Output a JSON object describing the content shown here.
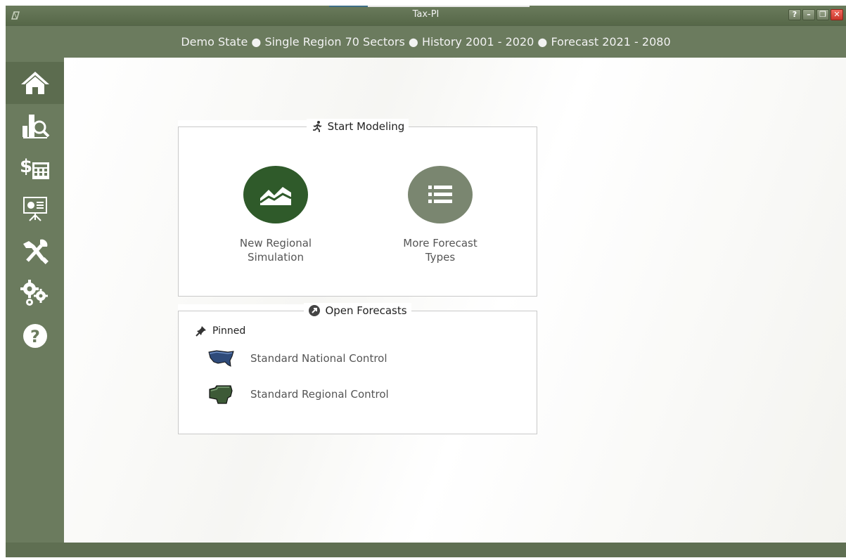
{
  "window": {
    "title": "Tax-PI",
    "buttons": {
      "help": "?",
      "minimize": "–",
      "restore": "❐",
      "close": "✕"
    }
  },
  "infobar": {
    "text": "Demo State ● Single Region 70 Sectors ● History 2001 - 2020 ● Forecast 2021 - 2080"
  },
  "sidebar": {
    "items": [
      {
        "name": "home",
        "icon": "home-icon"
      },
      {
        "name": "results",
        "icon": "chart-search-icon"
      },
      {
        "name": "tax-calculator",
        "icon": "dollar-calculator-icon"
      },
      {
        "name": "presentation",
        "icon": "presentation-board-icon"
      },
      {
        "name": "tools",
        "icon": "tools-icon"
      },
      {
        "name": "settings",
        "icon": "gears-icon"
      },
      {
        "name": "help",
        "icon": "question-icon"
      }
    ]
  },
  "start_modeling": {
    "title": "Start Modeling",
    "buttons": [
      {
        "label": "New Regional\nSimulation",
        "icon": "area-chart-icon",
        "color": "#2f5a2a"
      },
      {
        "label": "More Forecast\nTypes",
        "icon": "list-icon",
        "color": "#7a8670"
      }
    ]
  },
  "open_forecasts": {
    "title": "Open Forecasts",
    "pinned_label": "Pinned",
    "items": [
      {
        "label": "Standard National Control",
        "icon": "us-map-icon"
      },
      {
        "label": "Standard Regional Control",
        "icon": "region-map-icon"
      }
    ]
  },
  "colors": {
    "chrome": "#6b7b5e",
    "primary_green": "#2f5a2a",
    "secondary_green": "#7a8670"
  }
}
